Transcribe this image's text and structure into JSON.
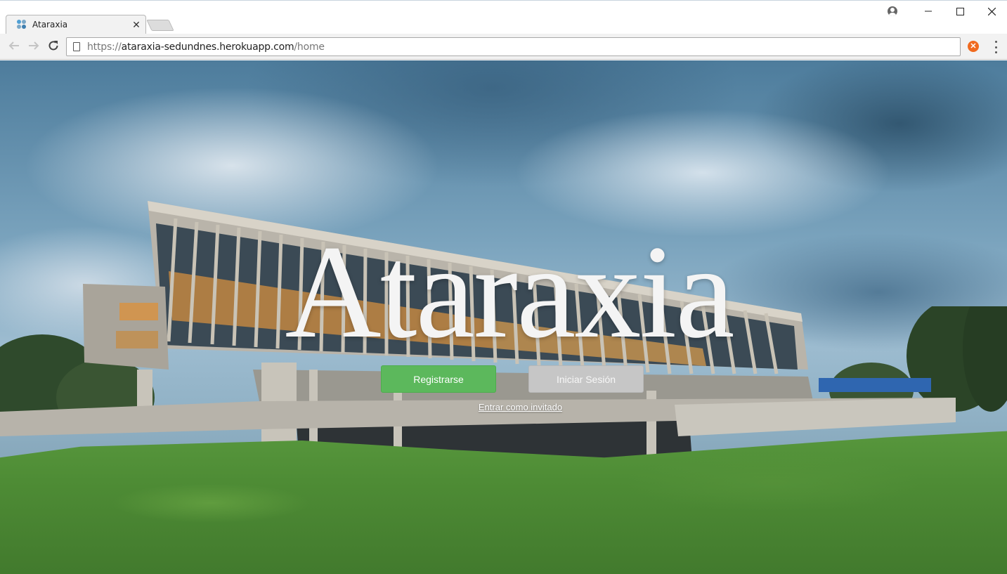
{
  "browser": {
    "tab_title": "Ataraxia",
    "url_scheme": "https://",
    "url_host": "ataraxia-sedundnes.herokuapp.com",
    "url_path": "/home",
    "extension_badge": "✕"
  },
  "hero": {
    "title": "Ataraxia",
    "register_label": "Registrarse",
    "login_label": "Iniciar Sesión",
    "guest_link": "Entrar como invitado"
  },
  "colors": {
    "register_button": "#5cb85c",
    "login_button": "#c6c6c6",
    "title_text": "#f4f4f4"
  }
}
